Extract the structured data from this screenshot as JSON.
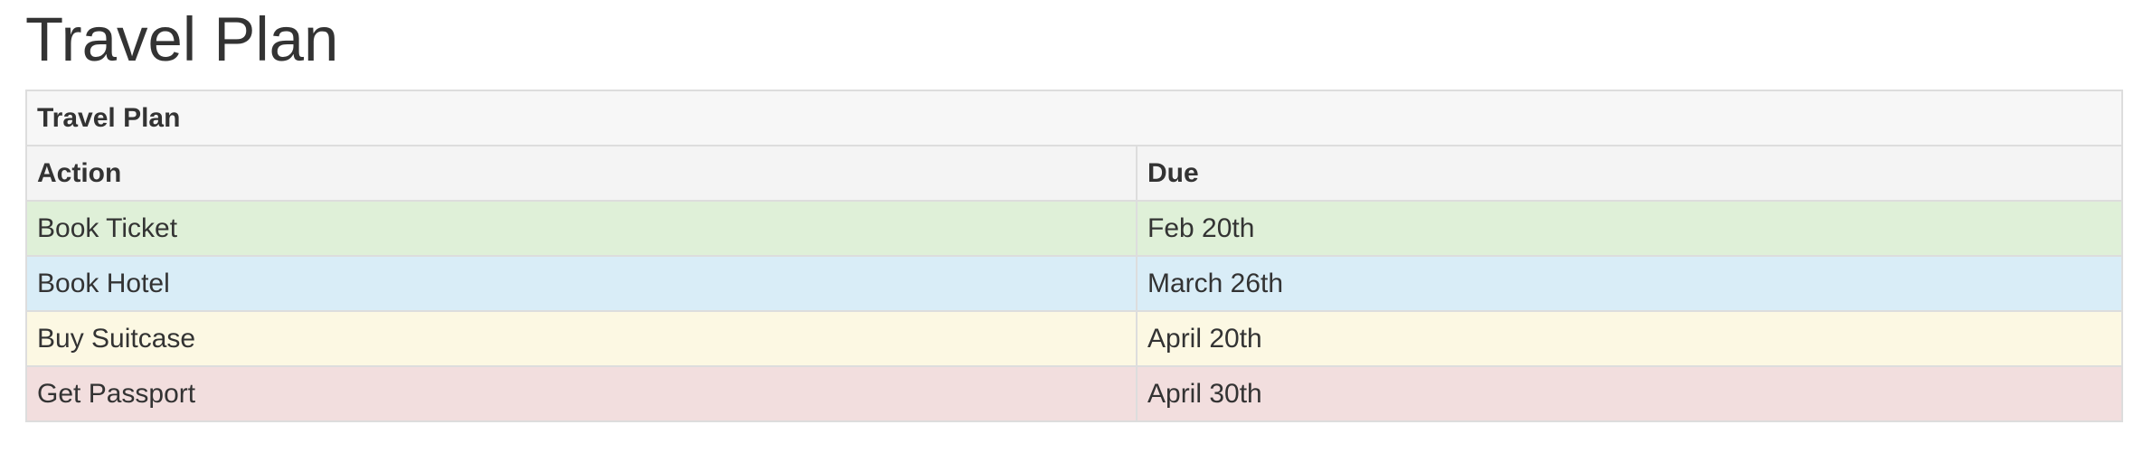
{
  "page": {
    "title": "Travel Plan"
  },
  "table": {
    "caption": "Travel Plan",
    "columns": [
      "Action",
      "Due"
    ],
    "rows": [
      {
        "action": "Book Ticket",
        "due": "Feb 20th",
        "status": "success",
        "color": "#dff0d8"
      },
      {
        "action": "Book Hotel",
        "due": "March 26th",
        "status": "info",
        "color": "#d9edf7"
      },
      {
        "action": "Buy Suitcase",
        "due": "April 20th",
        "status": "warning",
        "color": "#fcf8e3"
      },
      {
        "action": "Get Passport",
        "due": "April 30th",
        "status": "danger",
        "color": "#f2dede"
      }
    ]
  }
}
